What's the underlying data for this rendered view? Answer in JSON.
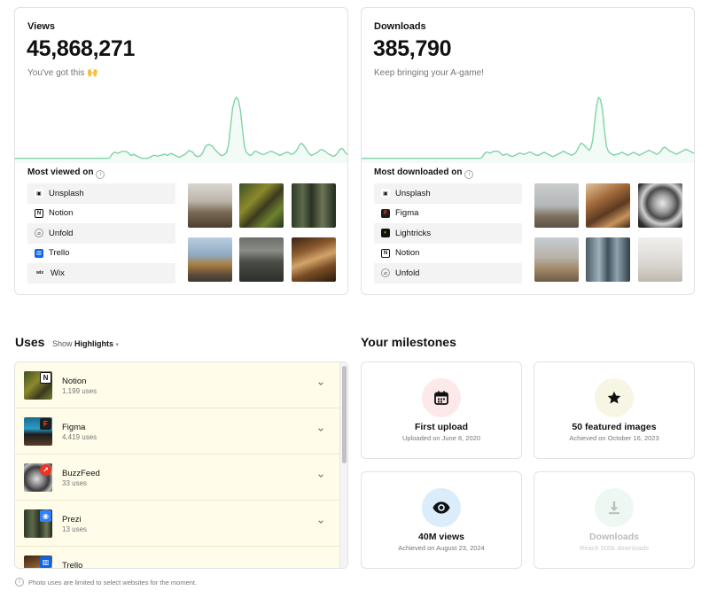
{
  "views": {
    "label": "Views",
    "value": "45,868,271",
    "subtitle": "You've got this 🙌",
    "most_title": "Most viewed on",
    "sites": [
      {
        "name": "Unsplash",
        "icon": "unsplash-icon"
      },
      {
        "name": "Notion",
        "icon": "notion-icon"
      },
      {
        "name": "Unfold",
        "icon": "unfold-icon"
      },
      {
        "name": "Trello",
        "icon": "trello-icon"
      },
      {
        "name": "Wix",
        "icon": "wix-icon"
      }
    ],
    "trend": [
      2,
      2,
      2,
      2,
      2,
      2,
      2,
      2,
      2,
      2,
      2,
      2,
      2,
      2,
      2,
      2,
      2,
      2,
      2,
      2,
      2,
      2,
      2,
      2,
      2,
      2,
      2,
      2,
      2,
      2,
      2,
      2,
      2,
      2,
      2,
      2,
      2,
      2,
      2,
      2,
      2,
      2,
      2,
      2,
      2,
      2,
      2,
      2,
      3,
      6,
      8,
      8,
      7,
      8,
      9,
      9,
      9,
      8,
      6,
      5,
      6,
      5,
      4,
      3,
      2,
      2,
      2,
      2,
      3,
      4,
      5,
      5,
      4,
      5,
      5,
      6,
      6,
      5,
      6,
      7,
      6,
      5,
      4,
      3,
      4,
      5,
      6,
      8,
      10,
      9,
      8,
      5,
      4,
      4,
      5,
      8,
      13,
      15,
      16,
      15,
      14,
      11,
      9,
      7,
      5,
      5,
      6,
      8,
      16,
      34,
      52,
      60,
      63,
      60,
      50,
      32,
      14,
      8,
      6,
      5,
      6,
      9,
      9,
      8,
      7,
      6,
      6,
      7,
      8,
      9,
      9,
      8,
      7,
      6,
      5,
      6,
      7,
      8,
      8,
      7,
      6,
      7,
      9,
      12,
      16,
      17,
      15,
      12,
      9,
      6,
      5,
      6,
      7,
      8,
      10,
      11,
      10,
      9,
      7,
      6,
      5,
      4,
      5,
      7,
      10,
      12,
      11,
      8,
      6,
      5
    ]
  },
  "downloads": {
    "label": "Downloads",
    "value": "385,790",
    "subtitle": "Keep bringing your A-game!",
    "most_title": "Most downloaded on",
    "sites": [
      {
        "name": "Unsplash",
        "icon": "unsplash-icon"
      },
      {
        "name": "Figma",
        "icon": "figma-icon"
      },
      {
        "name": "Lightricks",
        "icon": "lightricks-icon"
      },
      {
        "name": "Notion",
        "icon": "notion-icon"
      },
      {
        "name": "Unfold",
        "icon": "unfold-icon"
      }
    ],
    "trend": [
      2,
      2,
      2,
      2,
      2,
      2,
      2,
      2,
      2,
      2,
      2,
      2,
      2,
      2,
      2,
      2,
      2,
      2,
      2,
      2,
      2,
      2,
      2,
      2,
      2,
      2,
      2,
      2,
      2,
      2,
      2,
      2,
      2,
      2,
      2,
      2,
      2,
      2,
      2,
      2,
      2,
      2,
      2,
      2,
      2,
      2,
      2,
      2,
      2,
      2,
      2,
      2,
      2,
      2,
      2,
      2,
      2,
      2,
      2,
      2,
      2,
      2,
      3,
      6,
      8,
      8,
      7,
      8,
      9,
      9,
      9,
      8,
      6,
      5,
      6,
      6,
      5,
      4,
      4,
      5,
      6,
      7,
      7,
      6,
      6,
      7,
      8,
      8,
      7,
      6,
      5,
      5,
      6,
      7,
      8,
      7,
      6,
      5,
      4,
      4,
      5,
      6,
      7,
      8,
      9,
      8,
      7,
      6,
      5,
      6,
      7,
      10,
      14,
      17,
      16,
      14,
      12,
      10,
      12,
      20,
      38,
      54,
      62,
      60,
      50,
      30,
      14,
      9,
      7,
      6,
      5,
      6,
      6,
      7,
      8,
      7,
      6,
      5,
      6,
      7,
      8,
      7,
      6,
      5,
      6,
      7,
      8,
      9,
      10,
      9,
      8,
      7,
      6,
      7,
      9,
      12,
      13,
      12,
      10,
      9,
      8,
      7,
      6,
      7,
      8,
      9,
      10,
      11,
      10,
      9,
      8,
      7,
      6
    ]
  },
  "uses": {
    "title": "Uses",
    "show_prefix": "Show",
    "show_value": "Highlights",
    "items": [
      {
        "name": "Notion",
        "count": "1,199 uses",
        "badge": "N"
      },
      {
        "name": "Figma",
        "count": "4,419 uses",
        "badge": "F"
      },
      {
        "name": "BuzzFeed",
        "count": "33 uses",
        "badge": "↗"
      },
      {
        "name": "Prezi",
        "count": "13 uses",
        "badge": "◉"
      },
      {
        "name": "Trello",
        "count": "",
        "badge": "▥"
      }
    ],
    "footnote": "Photo uses are limited to select websites for the moment."
  },
  "milestones": {
    "title": "Your milestones",
    "items": [
      {
        "title": "First upload",
        "subtitle": "Uploaded on June 8, 2020",
        "icon": "calendar-icon",
        "color": "#fde8ea",
        "locked": false
      },
      {
        "title": "50 featured images",
        "subtitle": "Achieved on October 16, 2023",
        "icon": "star-icon",
        "color": "#f7f5e4",
        "locked": false
      },
      {
        "title": "40M views",
        "subtitle": "Achieved on August 23, 2024",
        "icon": "eye-icon",
        "color": "#dbedfb",
        "locked": false
      },
      {
        "title": "Downloads",
        "subtitle": "Reach 500k downloads",
        "icon": "download-icon",
        "color": "#eef8f3",
        "locked": true
      }
    ]
  },
  "colors": {
    "trend_line": "#7fd4a6",
    "trend_fill": "#f3fbf6",
    "uses_bg": "#fffde9"
  }
}
